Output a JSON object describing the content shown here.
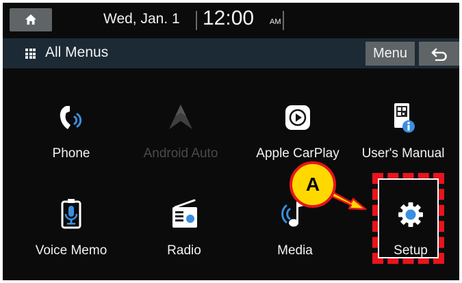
{
  "status_bar": {
    "date": "Wed, Jan. 1",
    "time": "12:00",
    "ampm": "AM"
  },
  "title_bar": {
    "title": "All Menus",
    "menu_button": "Menu"
  },
  "menu_items": [
    {
      "label": "Phone",
      "icon": "phone-icon",
      "enabled": true
    },
    {
      "label": "Android Auto",
      "icon": "android-auto-icon",
      "enabled": false
    },
    {
      "label": "Apple CarPlay",
      "icon": "carplay-icon",
      "enabled": true
    },
    {
      "label": "User's Manual",
      "icon": "manual-icon",
      "enabled": true
    },
    {
      "label": "Voice Memo",
      "icon": "microphone-icon",
      "enabled": true
    },
    {
      "label": "Radio",
      "icon": "radio-icon",
      "enabled": true
    },
    {
      "label": "Media",
      "icon": "music-icon",
      "enabled": true
    },
    {
      "label": "Setup",
      "icon": "gear-icon",
      "enabled": true
    }
  ],
  "annotation": {
    "callout_label": "A"
  },
  "colors": {
    "accent_blue": "#3a8fe0",
    "annotation_red": "#e8141c",
    "callout_yellow": "#ffd800",
    "button_gray": "#5f6466",
    "titlebar_bg": "#1c2a35"
  }
}
